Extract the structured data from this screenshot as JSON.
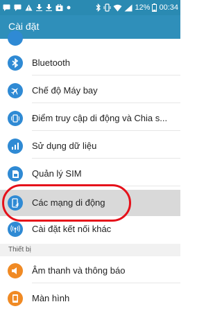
{
  "status_bar": {
    "battery_percent": "12%",
    "time": "00:34",
    "left_icons": [
      "sms-icon",
      "message-icon",
      "warning-icon",
      "download-icon",
      "download-icon",
      "shop-icon",
      "more-dots-icon"
    ],
    "right_icons": [
      "bluetooth-icon",
      "vibrate-icon",
      "wifi-icon",
      "signal-icon",
      "battery-icon"
    ]
  },
  "app_bar": {
    "title": "Cài đặt"
  },
  "rows": [
    {
      "label": "Bluetooth",
      "icon": "bluetooth-icon",
      "color": "#2f8ad4"
    },
    {
      "label": "Chế độ Máy bay",
      "icon": "airplane-icon",
      "color": "#2f8ad4"
    },
    {
      "label": "Điểm truy cập di động và Chia s...",
      "icon": "hotspot-icon",
      "color": "#2f8ad4"
    },
    {
      "label": "Sử dụng dữ liệu",
      "icon": "data-usage-icon",
      "color": "#2f8ad4"
    },
    {
      "label": "Quản lý SIM",
      "icon": "sim-icon",
      "color": "#2f8ad4"
    },
    {
      "label": "Các mạng di động",
      "icon": "mobile-network-icon",
      "color": "#2f8ad4"
    },
    {
      "label": "Cài đặt kết nối khác",
      "icon": "more-connections-icon",
      "color": "#2f8ad4"
    }
  ],
  "section_header": "Thiết bị",
  "device_rows": [
    {
      "label": "Âm thanh và thông báo",
      "icon": "sound-icon",
      "color": "#f08a24"
    },
    {
      "label": "Màn hình",
      "icon": "display-icon",
      "color": "#f08a24"
    }
  ],
  "colors": {
    "status_bar": "#2a8ab2",
    "app_bar": "#2f8fba",
    "highlight": "#d9d9d9",
    "annotation": "#e5101a"
  }
}
